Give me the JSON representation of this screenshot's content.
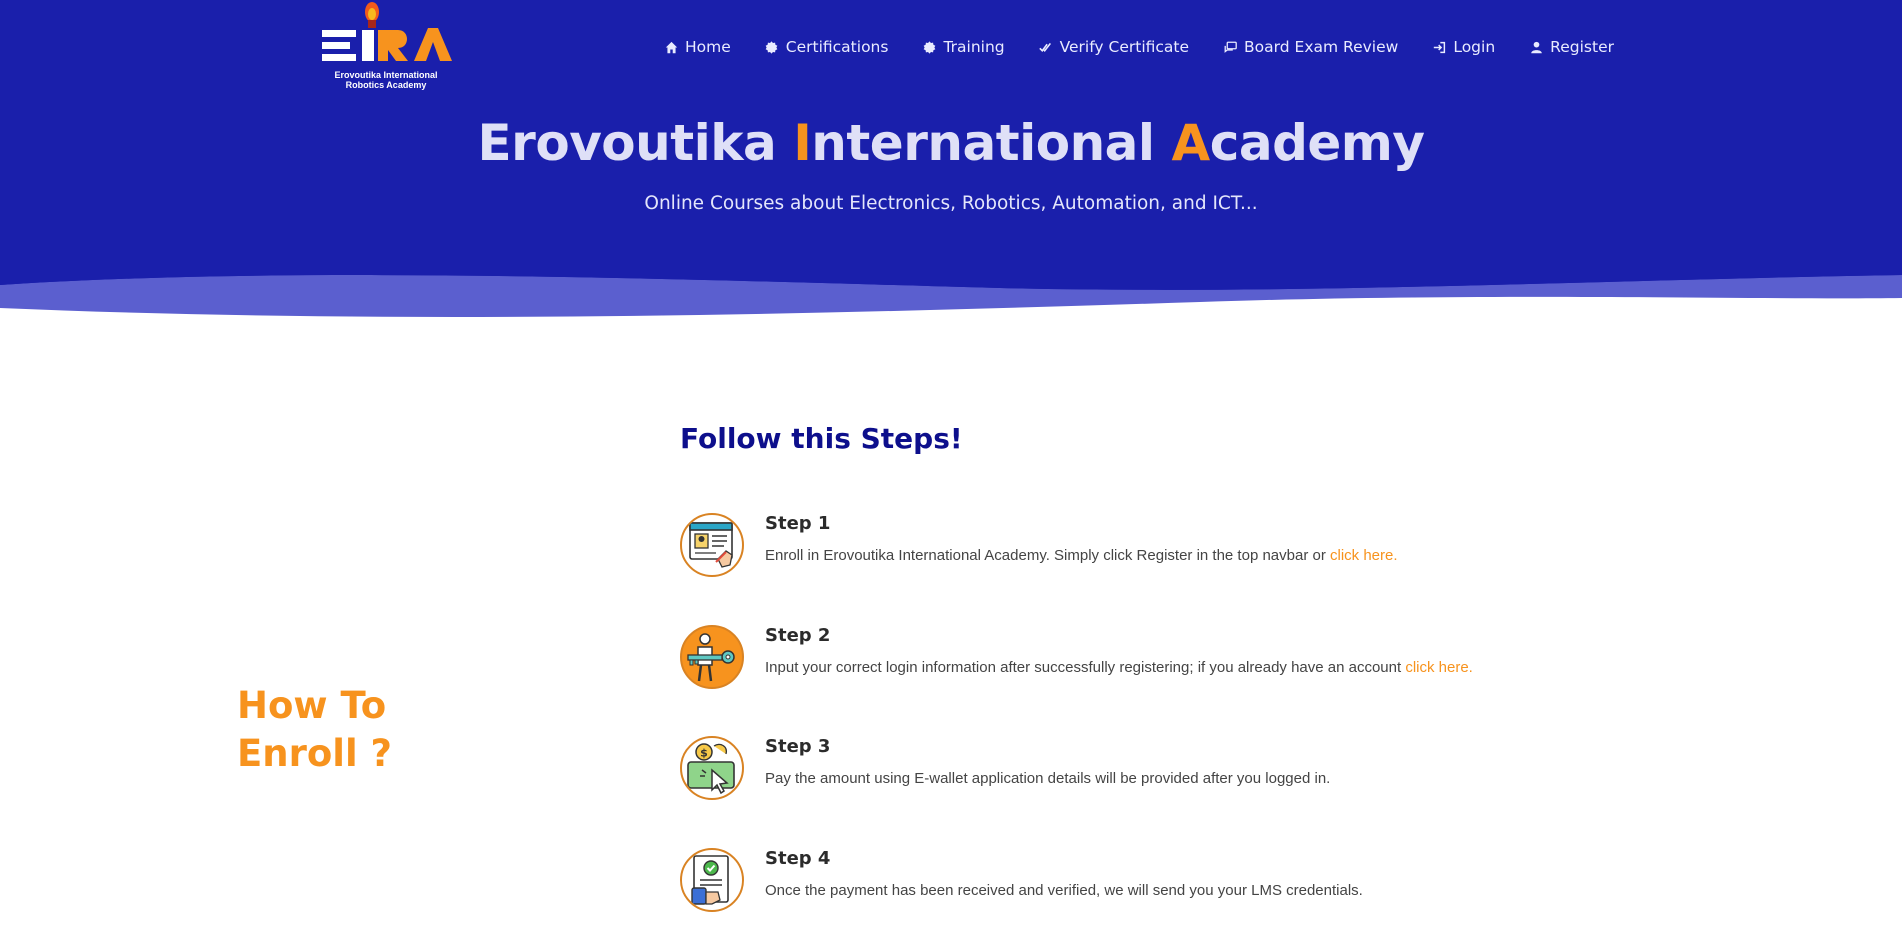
{
  "logo": {
    "line1": "Erovoutika International",
    "line2": "Robotics Academy",
    "letters": "EIRA"
  },
  "nav": [
    {
      "label": "Home",
      "icon": "home-icon"
    },
    {
      "label": "Certifications",
      "icon": "badge-icon"
    },
    {
      "label": "Training",
      "icon": "badge-icon"
    },
    {
      "label": "Verify Certificate",
      "icon": "double-check-icon"
    },
    {
      "label": "Board Exam Review",
      "icon": "chat-icon"
    },
    {
      "label": "Login",
      "icon": "login-icon"
    },
    {
      "label": "Register",
      "icon": "user-icon"
    }
  ],
  "hero": {
    "title_part1": "Erovoutika ",
    "title_accent1": "I",
    "title_part2": "nternational ",
    "title_accent2": "A",
    "title_part3": "cademy",
    "subtitle": "Online Courses about Electronics, Robotics, Automation, and ICT..."
  },
  "howto": {
    "line1": "How To",
    "line2": "Enroll ?"
  },
  "steps_title": "Follow this Steps!",
  "steps": [
    {
      "title": "Step 1",
      "text": "Enroll in Erovoutika International Academy. Simply click Register in the top navbar or ",
      "link": "click here."
    },
    {
      "title": "Step 2",
      "text": "Input your correct login information after successfully registering; if you already have an account ",
      "link": "click here."
    },
    {
      "title": "Step 3",
      "text": "Pay the amount using E-wallet application details will be provided after you logged in.",
      "link": ""
    },
    {
      "title": "Step 4",
      "text": "Once the payment has been received and verified, we will send you your LMS credentials.",
      "link": ""
    }
  ],
  "colors": {
    "hero_bg": "#1a1fab",
    "accent": "#f7931e",
    "heading_blue": "#0d0f8c"
  }
}
